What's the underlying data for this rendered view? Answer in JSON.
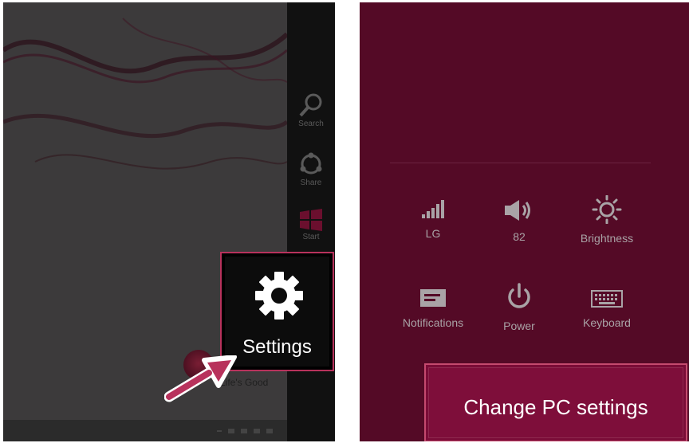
{
  "charms": [
    {
      "label": "Search",
      "icon": "search-icon"
    },
    {
      "label": "Share",
      "icon": "share-icon"
    },
    {
      "label": "Start",
      "icon": "windows-logo-icon"
    }
  ],
  "settings_tile": {
    "label": "Settings",
    "icon": "gear-icon"
  },
  "desktop": {
    "slogan": "Life's Good"
  },
  "quick_settings": [
    {
      "label": "LG",
      "icon": "network-signal-icon"
    },
    {
      "label": "82",
      "icon": "volume-icon"
    },
    {
      "label": "Brightness",
      "icon": "brightness-icon"
    },
    {
      "label": "Notifications",
      "icon": "notifications-icon"
    },
    {
      "label": "Power",
      "icon": "power-icon"
    },
    {
      "label": "Keyboard",
      "icon": "keyboard-icon"
    }
  ],
  "change_pc_settings": {
    "label": "Change PC settings"
  },
  "colors": {
    "accent_border": "#b8325c",
    "panel_background": "#540a26",
    "button_background": "#7e0e3a"
  }
}
